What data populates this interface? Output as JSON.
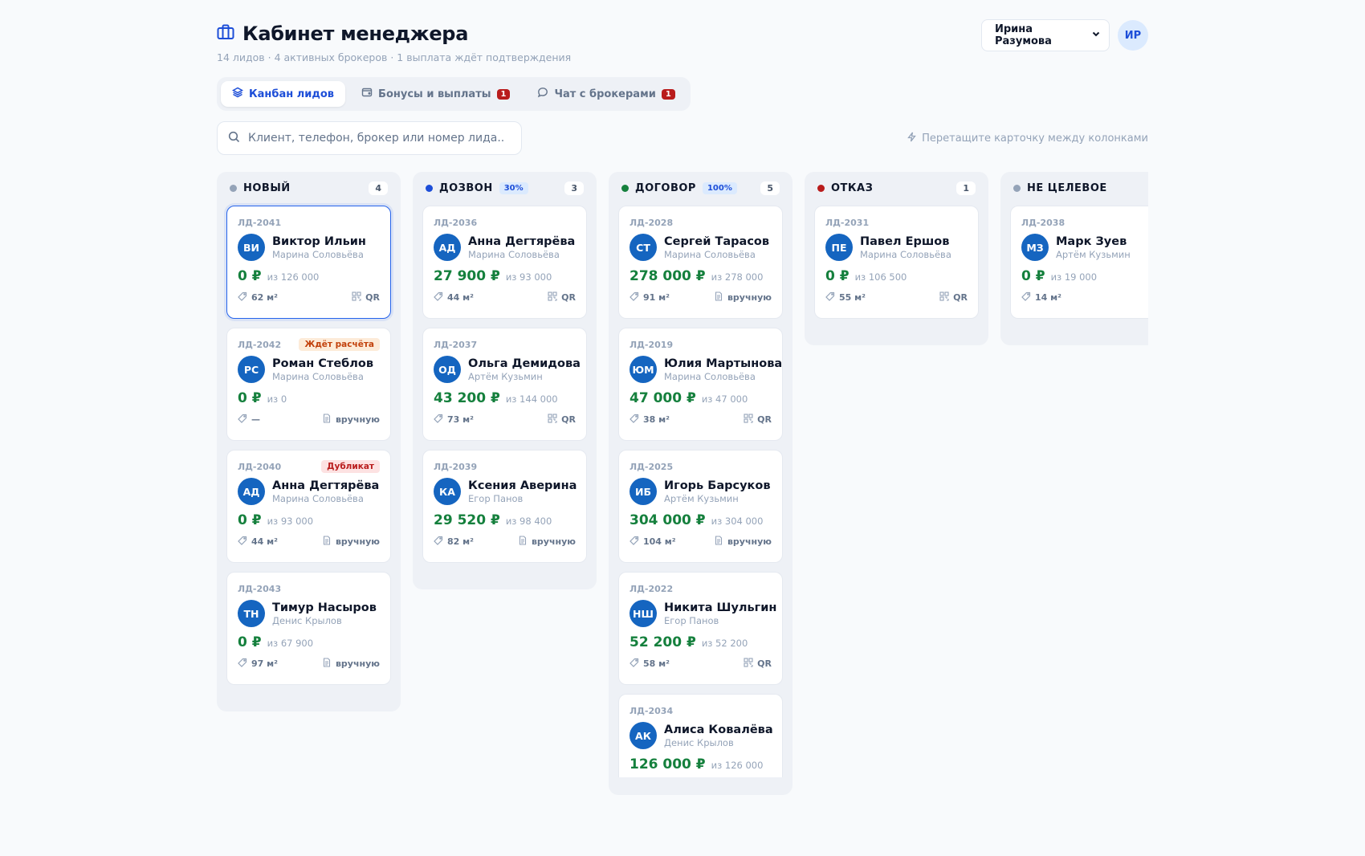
{
  "header": {
    "title": "Кабинет менеджера",
    "subtitle": "14 лидов · 4 активных брокеров · 1 выплата ждёт подтверждения",
    "user_name": "Ирина Разумова",
    "user_initials": "ИР"
  },
  "tabs": [
    {
      "label": "Канбан лидов",
      "badge": ""
    },
    {
      "label": "Бонусы и выплаты",
      "badge": "1"
    },
    {
      "label": "Чат с брокерами",
      "badge": "1"
    }
  ],
  "search": {
    "placeholder": "Клиент, телефон, брокер или номер лида..."
  },
  "hint": "Перетащите карточку между колонками",
  "colors": {
    "accent": "#1d4ed8",
    "avatar": "#1565c0",
    "money": "#15803d",
    "danger": "#b91c1c"
  },
  "columns": [
    {
      "title": "НОВЫЙ",
      "dot": "#94a3b8",
      "pct": "",
      "count": "4",
      "cards": [
        {
          "id": "ЛД-2041",
          "tag": "",
          "tag_type": "",
          "initials": "ВИ",
          "name": "Виктор Ильин",
          "broker": "Марина Соловьёва",
          "paid": "0 ₽",
          "of": "из 126 000",
          "area": "62 м²",
          "source": "QR",
          "source_icon": "qr-icon",
          "selected": true
        },
        {
          "id": "ЛД-2042",
          "tag": "Ждёт расчёта",
          "tag_type": "wait",
          "initials": "РС",
          "name": "Роман Стеблов",
          "broker": "Марина Соловьёва",
          "paid": "0 ₽",
          "of": "из 0",
          "area": "—",
          "source": "вручную",
          "source_icon": "document-icon"
        },
        {
          "id": "ЛД-2040",
          "tag": "Дубликат",
          "tag_type": "dup",
          "initials": "АД",
          "name": "Анна Дегтярёва",
          "broker": "Марина Соловьёва",
          "paid": "0 ₽",
          "of": "из 93 000",
          "area": "44 м²",
          "source": "вручную",
          "source_icon": "document-icon"
        },
        {
          "id": "ЛД-2043",
          "tag": "",
          "tag_type": "",
          "initials": "ТН",
          "name": "Тимур Насыров",
          "broker": "Денис Крылов",
          "paid": "0 ₽",
          "of": "из 67 900",
          "area": "97 м²",
          "source": "вручную",
          "source_icon": "document-icon"
        }
      ]
    },
    {
      "title": "ДОЗВОН",
      "dot": "#1d4ed8",
      "pct": "30%",
      "count": "3",
      "cards": [
        {
          "id": "ЛД-2036",
          "tag": "",
          "tag_type": "",
          "initials": "АД",
          "name": "Анна Дегтярёва",
          "broker": "Марина Соловьёва",
          "paid": "27 900 ₽",
          "of": "из 93 000",
          "area": "44 м²",
          "source": "QR",
          "source_icon": "qr-icon"
        },
        {
          "id": "ЛД-2037",
          "tag": "",
          "tag_type": "",
          "initials": "ОД",
          "name": "Ольга Демидова",
          "broker": "Артём Кузьмин",
          "paid": "43 200 ₽",
          "of": "из 144 000",
          "area": "73 м²",
          "source": "QR",
          "source_icon": "qr-icon"
        },
        {
          "id": "ЛД-2039",
          "tag": "",
          "tag_type": "",
          "initials": "КА",
          "name": "Ксения Аверина",
          "broker": "Егор Панов",
          "paid": "29 520 ₽",
          "of": "из 98 400",
          "area": "82 м²",
          "source": "вручную",
          "source_icon": "document-icon"
        }
      ]
    },
    {
      "title": "ДОГОВОР",
      "dot": "#15803d",
      "pct": "100%",
      "count": "5",
      "cards": [
        {
          "id": "ЛД-2028",
          "tag": "",
          "tag_type": "",
          "initials": "СТ",
          "name": "Сергей Тарасов",
          "broker": "Марина Соловьёва",
          "paid": "278 000 ₽",
          "of": "из 278 000",
          "area": "91 м²",
          "source": "вручную",
          "source_icon": "document-icon"
        },
        {
          "id": "ЛД-2019",
          "tag": "",
          "tag_type": "",
          "initials": "ЮМ",
          "name": "Юлия Мартынова",
          "broker": "Марина Соловьёва",
          "paid": "47 000 ₽",
          "of": "из 47 000",
          "area": "38 м²",
          "source": "QR",
          "source_icon": "qr-icon"
        },
        {
          "id": "ЛД-2025",
          "tag": "",
          "tag_type": "",
          "initials": "ИБ",
          "name": "Игорь Барсуков",
          "broker": "Артём Кузьмин",
          "paid": "304 000 ₽",
          "of": "из 304 000",
          "area": "104 м²",
          "source": "вручную",
          "source_icon": "document-icon"
        },
        {
          "id": "ЛД-2022",
          "tag": "",
          "tag_type": "",
          "initials": "НШ",
          "name": "Никита Шульгин",
          "broker": "Егор Панов",
          "paid": "52 200 ₽",
          "of": "из 52 200",
          "area": "58 м²",
          "source": "QR",
          "source_icon": "qr-icon"
        },
        {
          "id": "ЛД-2034",
          "tag": "",
          "tag_type": "",
          "initials": "АК",
          "name": "Алиса Ковалёва",
          "broker": "Денис Крылов",
          "paid": "126 000 ₽",
          "of": "из 126 000",
          "area": "",
          "source": "",
          "source_icon": "",
          "cut": true
        }
      ]
    },
    {
      "title": "ОТКАЗ",
      "dot": "#b91c1c",
      "pct": "",
      "count": "1",
      "cards": [
        {
          "id": "ЛД-2031",
          "tag": "",
          "tag_type": "",
          "initials": "ПЕ",
          "name": "Павел Ершов",
          "broker": "Марина Соловьёва",
          "paid": "0 ₽",
          "of": "из 106 500",
          "area": "55 м²",
          "source": "QR",
          "source_icon": "qr-icon"
        }
      ]
    },
    {
      "title": "НЕ ЦЕЛЕВОЕ",
      "dot": "#94a3b8",
      "pct": "",
      "count": "",
      "cards": [
        {
          "id": "ЛД-2038",
          "tag": "",
          "tag_type": "",
          "initials": "МЗ",
          "name": "Марк Зуев",
          "broker": "Артём Кузьмин",
          "paid": "0 ₽",
          "of": "из 19 000",
          "area": "14 м²",
          "source": "",
          "source_icon": "qr-icon"
        }
      ]
    }
  ]
}
